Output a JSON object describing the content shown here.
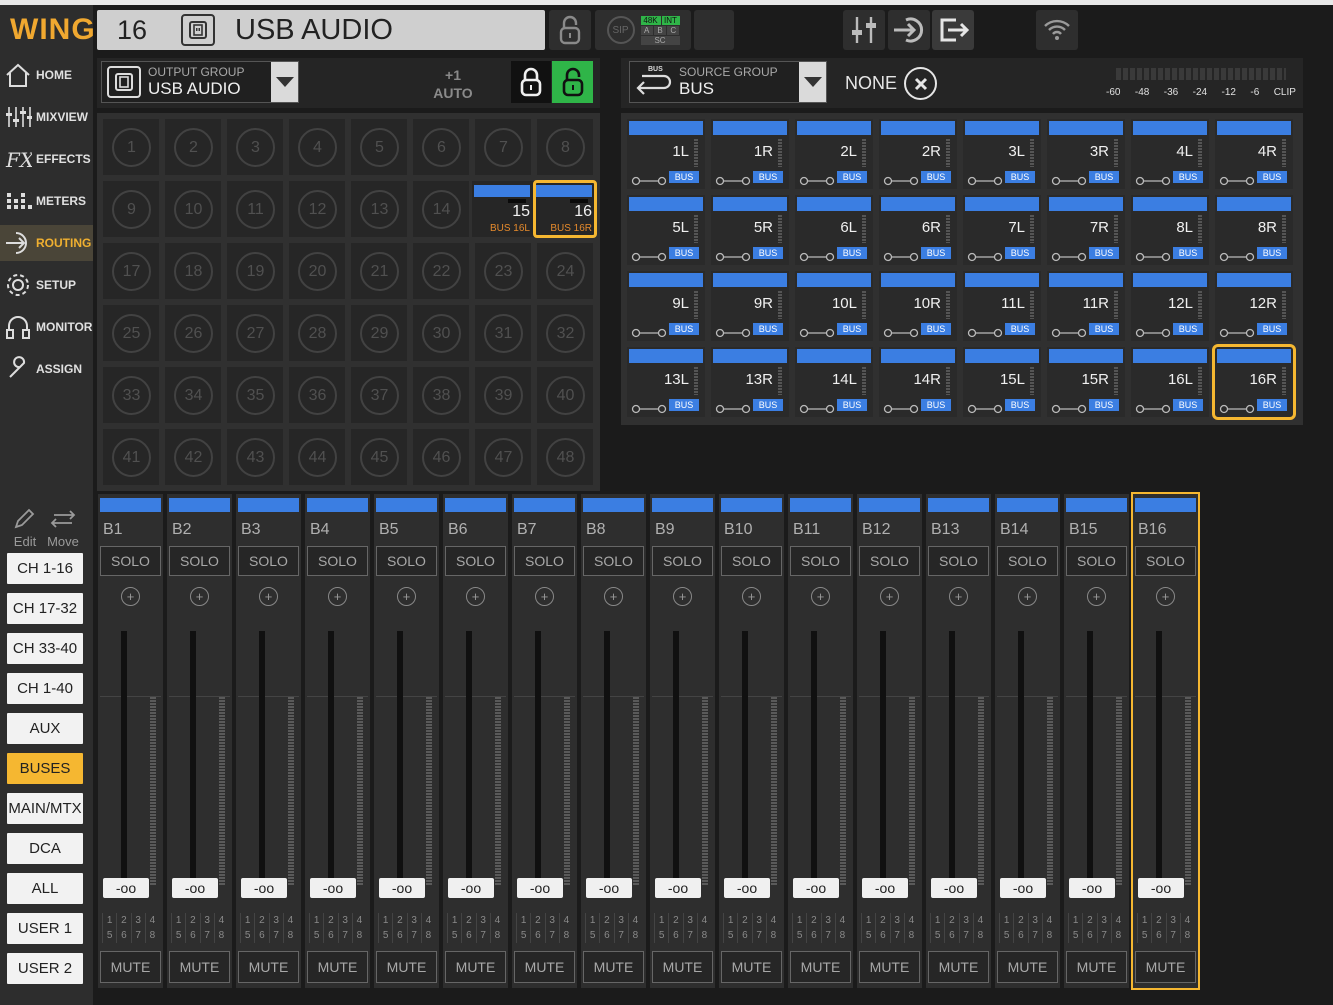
{
  "app": {
    "logo": "WING"
  },
  "sidebar": {
    "items": [
      {
        "label": "HOME",
        "icon": "home-icon",
        "active": false
      },
      {
        "label": "MIXVIEW",
        "icon": "faders-icon",
        "active": false
      },
      {
        "label": "EFFECTS",
        "icon": "fx-icon",
        "active": false
      },
      {
        "label": "METERS",
        "icon": "meters-icon",
        "active": false
      },
      {
        "label": "ROUTING",
        "icon": "routing-icon",
        "active": true
      },
      {
        "label": "SETUP",
        "icon": "gear-icon",
        "active": false
      },
      {
        "label": "MONITOR",
        "icon": "headphones-icon",
        "active": false
      },
      {
        "label": "ASSIGN",
        "icon": "wrench-icon",
        "active": false
      }
    ],
    "edit_label": "Edit",
    "move_label": "Move",
    "filters": [
      {
        "label": "CH 1-16",
        "active": false
      },
      {
        "label": "CH 17-32",
        "active": false
      },
      {
        "label": "CH 33-40",
        "active": false
      },
      {
        "label": "CH 1-40",
        "active": false
      },
      {
        "label": "AUX",
        "active": false
      },
      {
        "label": "BUSES",
        "active": true
      },
      {
        "label": "MAIN/MTX",
        "active": false
      },
      {
        "label": "DCA",
        "active": false
      },
      {
        "label": "ALL",
        "active": false
      },
      {
        "label": "USER 1",
        "active": false
      },
      {
        "label": "USER 2",
        "active": false
      }
    ]
  },
  "header": {
    "number": "16",
    "name": "USB AUDIO",
    "sip_label": "SIP",
    "rate_48k": "48K",
    "rate_int": "INT",
    "clock_a": "A",
    "clock_b": "B",
    "clock_c": "C",
    "clock_sc": "SC"
  },
  "output_group": {
    "caption": "OUTPUT GROUP",
    "value": "USB AUDIO",
    "step": "+1",
    "mode": "AUTO",
    "outputs": [
      "1",
      "2",
      "3",
      "4",
      "5",
      "6",
      "7",
      "8",
      "9",
      "10",
      "11",
      "12",
      "13",
      "14",
      "15",
      "16",
      "17",
      "18",
      "19",
      "20",
      "21",
      "22",
      "23",
      "24",
      "25",
      "26",
      "27",
      "28",
      "29",
      "30",
      "31",
      "32",
      "33",
      "34",
      "35",
      "36",
      "37",
      "38",
      "39",
      "40",
      "41",
      "42",
      "43",
      "44",
      "45",
      "46",
      "47",
      "48"
    ],
    "assigned": [
      {
        "index": 14,
        "number": "15",
        "source": "BUS 16L",
        "selected": false
      },
      {
        "index": 15,
        "number": "16",
        "source": "BUS 16R",
        "selected": true
      }
    ]
  },
  "source_group": {
    "caption": "SOURCE GROUP",
    "value": "BUS",
    "icon_label": "BUS",
    "none_label": "NONE",
    "meter_scale": [
      "-60",
      "-48",
      "-36",
      "-24",
      "-12",
      "-6",
      "CLIP"
    ],
    "tag": "BUS",
    "sources": [
      "1L",
      "1R",
      "2L",
      "2R",
      "3L",
      "3R",
      "4L",
      "4R",
      "5L",
      "5R",
      "6L",
      "6R",
      "7L",
      "7R",
      "8L",
      "8R",
      "9L",
      "9R",
      "10L",
      "10R",
      "11L",
      "11R",
      "12L",
      "12R",
      "13L",
      "13R",
      "14L",
      "14R",
      "15L",
      "15R",
      "16L",
      "16R"
    ],
    "selected_index": 31
  },
  "strips": {
    "solo_label": "SOLO",
    "mute_label": "MUTE",
    "fader_value": "-oo",
    "dca_numbers": [
      "1",
      "2",
      "3",
      "4",
      "5",
      "6",
      "7",
      "8"
    ],
    "names": [
      "B1",
      "B2",
      "B3",
      "B4",
      "B5",
      "B6",
      "B7",
      "B8",
      "B9",
      "B10",
      "B11",
      "B12",
      "B13",
      "B14",
      "B15",
      "B16"
    ],
    "selected_index": 15
  },
  "colors": {
    "accent": "#f5b731",
    "bus_blue": "#3b7ee2",
    "source_orange": "#e58a2c",
    "lock_green": "#2fb548"
  }
}
